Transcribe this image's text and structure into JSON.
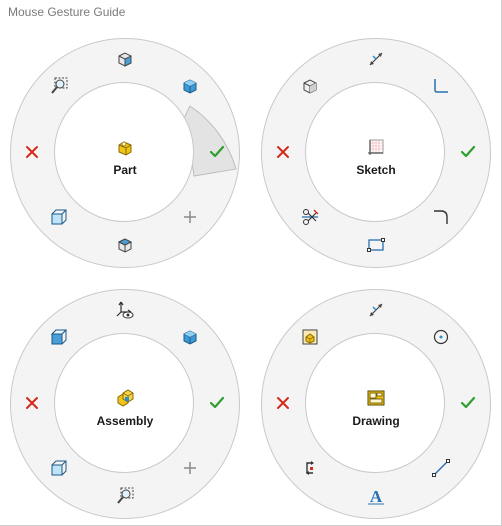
{
  "window": {
    "title": "Mouse Gesture Guide"
  },
  "wheels": {
    "part": {
      "label": "Part",
      "slots": [
        "view-front-icon",
        "view-isometric-icon",
        "confirm-check-icon",
        "add-plus-icon",
        "view-bottom-icon",
        "view-normal-to-icon",
        "cancel-x-icon",
        "zoom-to-area-icon"
      ],
      "highlighted_slot": "confirm-check-icon"
    },
    "sketch": {
      "label": "Sketch",
      "slots": [
        "smart-dimension-icon",
        "sketch-corner-icon",
        "confirm-check-icon",
        "sketch-fillet-icon",
        "rectangle-icon",
        "trim-entities-icon",
        "cancel-x-icon",
        "view-isometric-icon"
      ]
    },
    "assembly": {
      "label": "Assembly",
      "slots": [
        "move-component-icon",
        "view-isometric-icon",
        "confirm-check-icon",
        "add-plus-icon",
        "zoom-to-area-icon",
        "view-normal-to-icon",
        "cancel-x-icon",
        "view-front-icon"
      ]
    },
    "drawing": {
      "label": "Drawing",
      "slots": [
        "smart-dimension-icon",
        "circle-icon",
        "confirm-check-icon",
        "line-icon",
        "note-text-icon",
        "rotate-view-icon",
        "cancel-x-icon",
        "model-view-icon"
      ]
    }
  },
  "colors": {
    "ring": "#f4f4f4",
    "ring_border": "#c9c9c9",
    "highlight": "#e3e3e3",
    "check_green": "#2e9e2e",
    "cancel_red": "#d42a1a",
    "icon_blue": "#2a8fd1",
    "icon_gold": "#e8b400"
  }
}
